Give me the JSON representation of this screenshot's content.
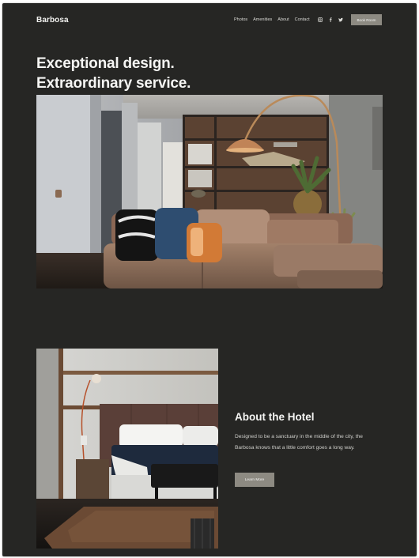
{
  "brand": "Barbosa",
  "nav": {
    "items": [
      "Photos",
      "Amenities",
      "About",
      "Contact"
    ],
    "icons": [
      "instagram-icon",
      "facebook-icon",
      "twitter-icon"
    ],
    "book_label": "Book Room"
  },
  "hero": {
    "line1": "Exceptional design.",
    "line2": "Extraordinary service."
  },
  "about": {
    "title": "About the Hotel",
    "body": "Designed to be a sanctuary in the middle of the city, the Barbosa knows that a little comfort goes a long way.",
    "button": "Learn More"
  },
  "colors": {
    "background": "#262624",
    "button": "#8d8a82",
    "text": "#f5f5f3"
  }
}
